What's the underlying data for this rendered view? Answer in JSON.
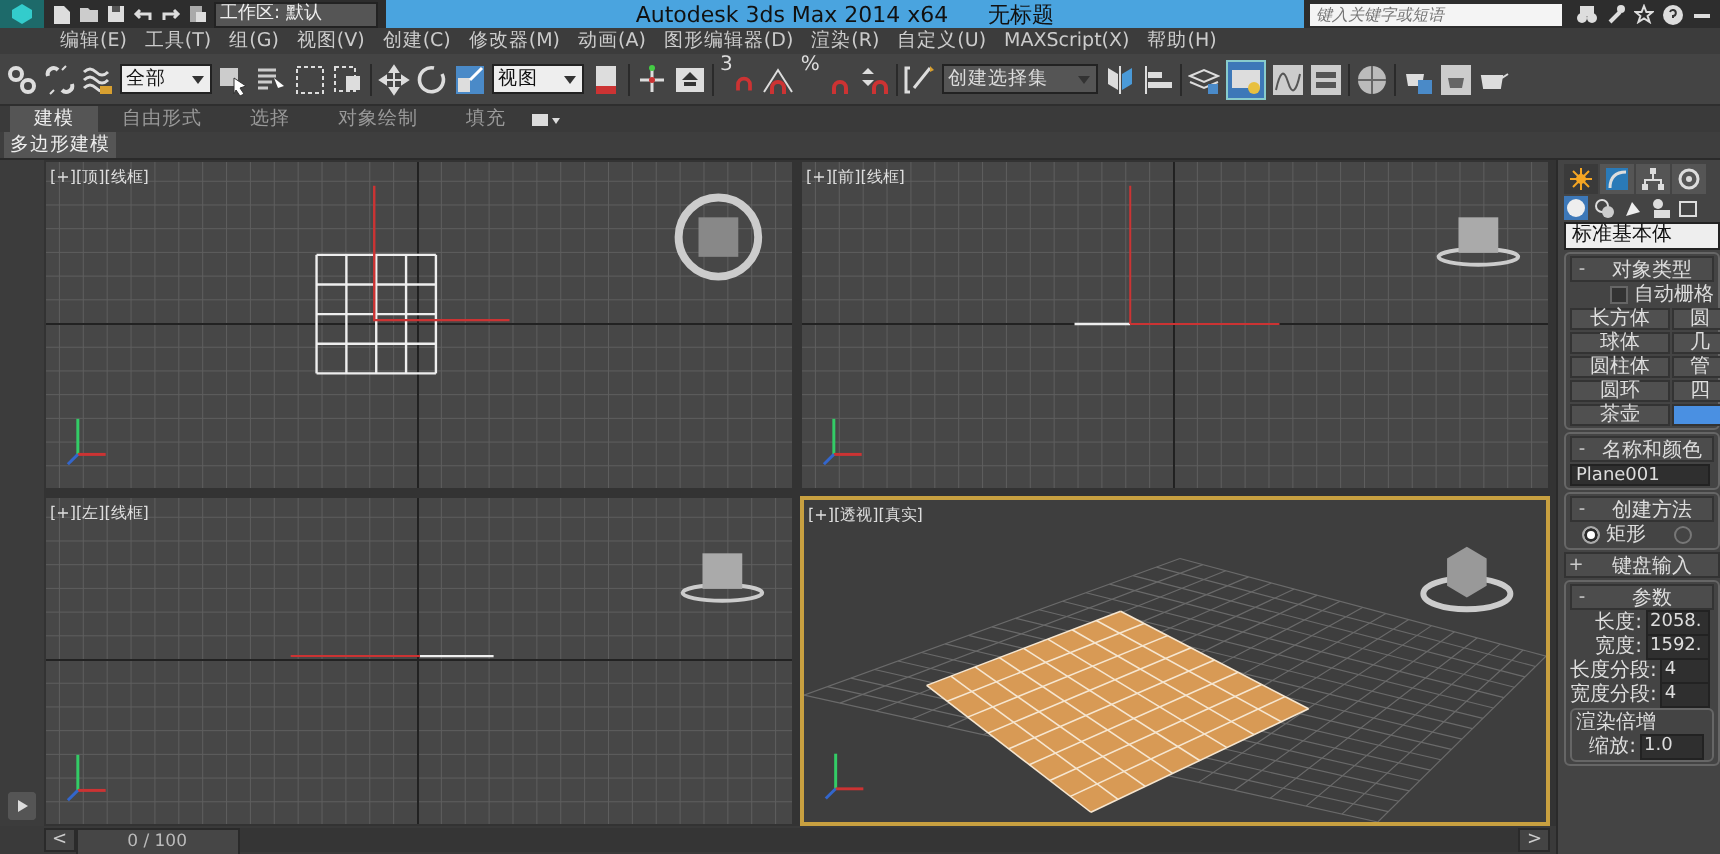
{
  "title_bar": {
    "workspace": "工作区: 默认",
    "app_title": "Autodesk 3ds Max  2014 x64",
    "document": "无标题",
    "search": {
      "placeholder": "键入关键字或短语"
    }
  },
  "menu": [
    "编辑(E)",
    "工具(T)",
    "组(G)",
    "视图(V)",
    "创建(C)",
    "修改器(M)",
    "动画(A)",
    "图形编辑器(D)",
    "渲染(R)",
    "自定义(U)",
    "MAXScript(X)",
    "帮助(H)"
  ],
  "toolbar": {
    "selection_filter": "全部",
    "coordinate_system": "视图",
    "snap_label": "3",
    "percent_label": "%",
    "named_selection": "创建选择集"
  },
  "ribbon_tabs": [
    {
      "label": "建模",
      "selected": true
    },
    {
      "label": "自由形式",
      "selected": false
    },
    {
      "label": "选择",
      "selected": false
    },
    {
      "label": "对象绘制",
      "selected": false
    },
    {
      "label": "填充",
      "selected": false
    }
  ],
  "ribbon_panel": "多边形建模",
  "viewports": [
    {
      "label": "[+][顶][线框]",
      "kind": "top",
      "selected": false
    },
    {
      "label": "[+][前][线框]",
      "kind": "front",
      "selected": false
    },
    {
      "label": "[+][左][线框]",
      "kind": "left",
      "selected": false
    },
    {
      "label": "[+][透视][真实]",
      "kind": "perspective",
      "selected": true
    }
  ],
  "time_slider": {
    "prev": "<",
    "position": "0 / 100",
    "level": 0,
    "next": ">"
  },
  "command_panel": {
    "category": "标准基本体",
    "object_type": {
      "toggle": "-",
      "title": "对象类型",
      "autogrid": {
        "label": "自动栅格",
        "checked": false
      },
      "buttons": [
        {
          "label": "长方体",
          "selected": false
        },
        {
          "label": "圆",
          "selected": false
        },
        {
          "label": "球体",
          "selected": false
        },
        {
          "label": "几",
          "selected": false
        },
        {
          "label": "圆柱体",
          "selected": false
        },
        {
          "label": "管",
          "selected": false
        },
        {
          "label": "圆环",
          "selected": false
        },
        {
          "label": "四",
          "selected": false
        },
        {
          "label": "茶壶",
          "selected": false
        },
        {
          "selected": true
        }
      ]
    },
    "name_color": {
      "toggle": "-",
      "title": "名称和颜色",
      "name": "Plane001"
    },
    "creation_method": {
      "toggle": "-",
      "title": "创建方法",
      "options": [
        {
          "label": "矩形",
          "selected": true
        },
        {
          "selected": false
        }
      ]
    },
    "keyboard_entry": {
      "toggle": "+",
      "title": "键盘输入"
    },
    "parameters": {
      "toggle": "-",
      "title": "参数",
      "fields": [
        {
          "label": "长度:",
          "value": "2058."
        },
        {
          "label": "宽度:",
          "value": "1592."
        },
        {
          "label": "长度分段:",
          "value": "4"
        },
        {
          "label": "宽度分段:",
          "value": "4"
        }
      ]
    },
    "render_multipliers": {
      "title": "渲染倍增",
      "fields": [
        {
          "label": "缩放:",
          "value": "1.0"
        }
      ]
    }
  }
}
